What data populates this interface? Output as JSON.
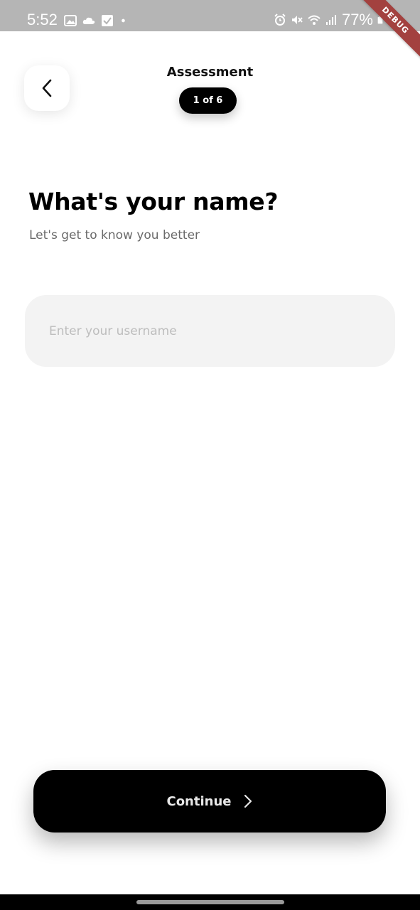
{
  "status_bar": {
    "time": "5:52",
    "battery": "77%",
    "left_icons": [
      "image-icon",
      "cloud-icon",
      "checkbox-icon",
      "dot-icon"
    ],
    "right_icons": [
      "alarm-icon",
      "mute-icon",
      "wifi-icon",
      "signal-icon",
      "battery-icon"
    ]
  },
  "debug_banner": "DEBUG",
  "header": {
    "title": "Assessment",
    "step": "1 of 6"
  },
  "question": {
    "title": "What's your name?",
    "subtitle": "Let's get to know you better"
  },
  "username_input": {
    "value": "",
    "placeholder": "Enter your username"
  },
  "continue_button": {
    "label": "Continue"
  },
  "colors": {
    "primary": "#000000",
    "background": "#ffffff",
    "input_bg": "#f3f3f3",
    "status_bar": "#b5b5b5",
    "debug": "#a3413f"
  }
}
